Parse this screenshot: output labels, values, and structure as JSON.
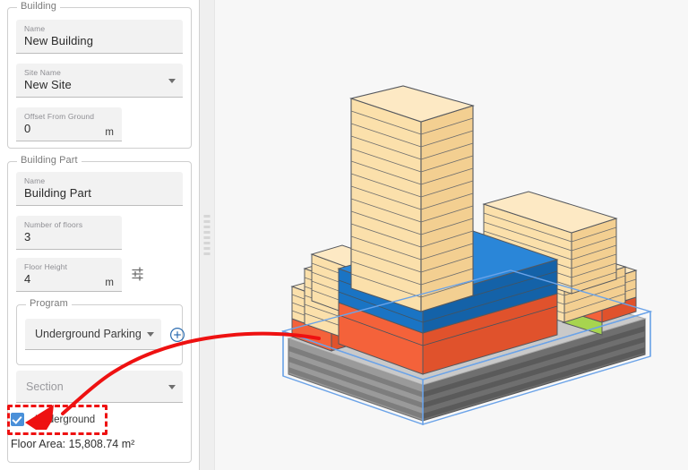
{
  "panel": {
    "building": {
      "legend": "Building",
      "name_label": "Name",
      "name_value": "New Building",
      "site_label": "Site Name",
      "site_value": "New Site",
      "offset_label": "Offset From Ground",
      "offset_value": "0",
      "offset_unit": "m"
    },
    "building_part": {
      "legend": "Building Part",
      "name_label": "Name",
      "name_value": "Building Part",
      "floors_label": "Number of floors",
      "floors_value": "3",
      "height_label": "Floor Height",
      "height_value": "4",
      "height_unit": "m",
      "tune_icon": "sliders-icon"
    },
    "program": {
      "legend": "Program",
      "selected": "Underground Parking",
      "add_icon": "add-circle-icon",
      "caret_icon": "chevron-down-icon"
    },
    "section": {
      "placeholder": "Section",
      "caret_icon": "chevron-down-icon"
    },
    "underground": {
      "label": "Underground",
      "checked": true,
      "check_icon": "checkmark-icon"
    },
    "floor_area": "Floor Area: 15,808.74 m²"
  },
  "splitter": {
    "grip_icon": "drag-handle-icon"
  },
  "viewport": {
    "name": "3d-model-viewport",
    "model": {
      "description": "Stacked massing model of a building with above-ground tan floor slabs, blue and orange program floors, a green patch and grey underground parking levels inside a blue selection box",
      "selection_box_color": "#6ba3e8"
    },
    "colors": {
      "background": "#f7f7f7",
      "slab_tan_light": "#fbe0ab",
      "slab_tan_dark": "#f3cf91",
      "program_blue": "#1a74c4",
      "program_blue_dark": "#1462a8",
      "program_orange": "#f4623a",
      "program_orange_dark": "#e0522c",
      "program_green": "#a7d44f",
      "underground_grey": "#8b8b8b",
      "underground_grey_dark": "#5f5f5f",
      "outline": "#55585e"
    }
  },
  "annotation": {
    "arrow_color": "#ee1111",
    "highlight_color": "#ee1111",
    "arrow_name": "callout-arrow",
    "highlight_name": "underground-checkbox-highlight"
  }
}
